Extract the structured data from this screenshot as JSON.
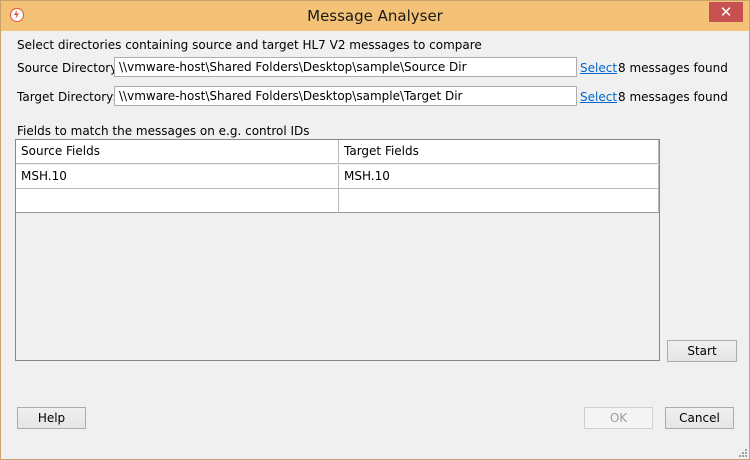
{
  "window": {
    "title": "Message Analyser",
    "close_label": "✕"
  },
  "intro": "Select directories containing source and target HL7 V2 messages to compare",
  "source": {
    "label": "Source Directory:",
    "value": "\\\\vmware-host\\Shared Folders\\Desktop\\sample\\Source Dir",
    "select_label": "Select",
    "status": "8 messages found"
  },
  "target": {
    "label": "Target Directory:",
    "value": "\\\\vmware-host\\Shared Folders\\Desktop\\sample\\Target Dir",
    "select_label": "Select",
    "status": "8 messages found"
  },
  "fields": {
    "label": "Fields to match the messages on e.g. control IDs",
    "columns": [
      "Source Fields",
      "Target Fields"
    ],
    "rows": [
      [
        "MSH.10",
        "MSH.10"
      ],
      [
        "",
        ""
      ]
    ]
  },
  "buttons": {
    "start": "Start",
    "help": "Help",
    "ok": "OK",
    "cancel": "Cancel"
  }
}
